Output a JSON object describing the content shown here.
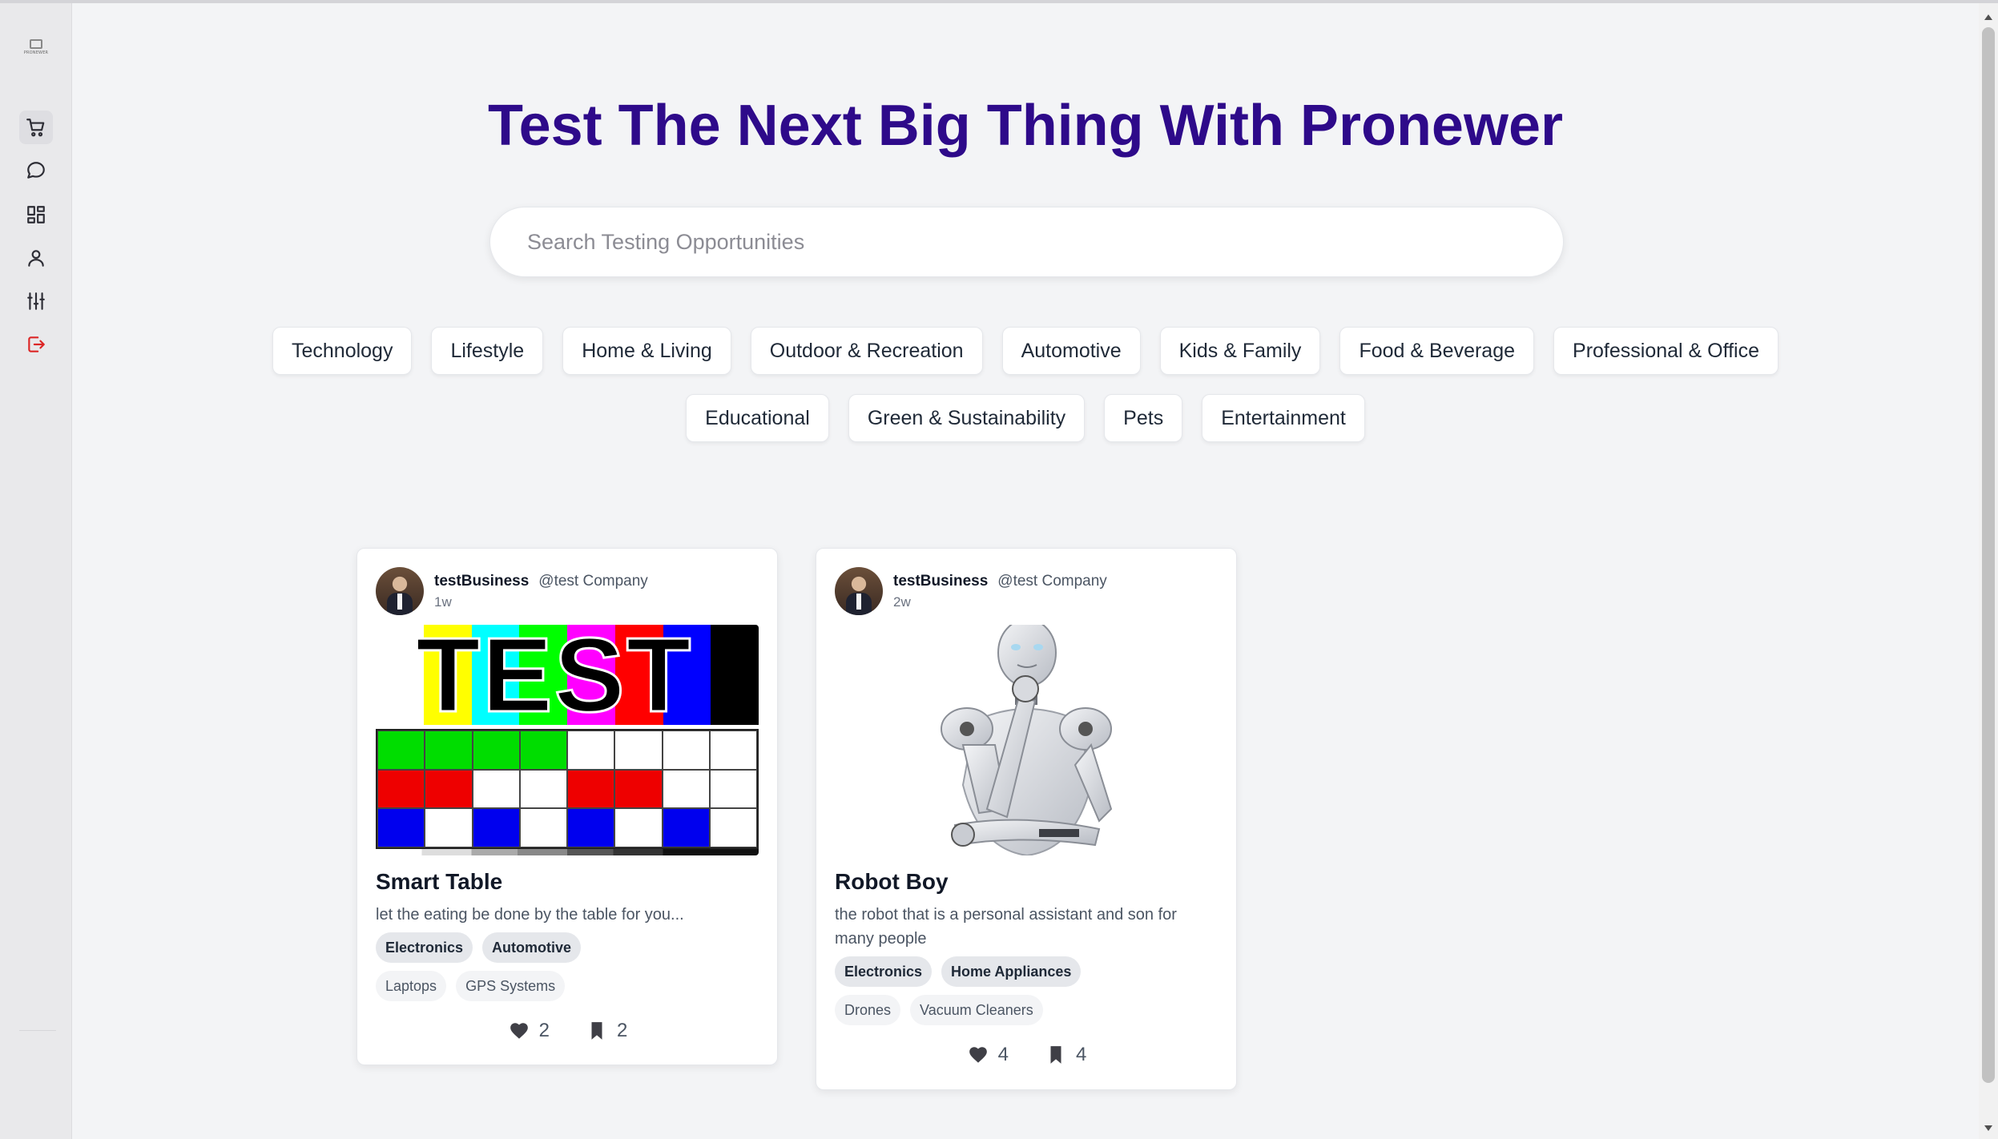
{
  "app": {
    "logo_text": "PRONEWER"
  },
  "sidebar": {
    "items": [
      {
        "name": "marketplace",
        "icon": "shopping-cart-icon"
      },
      {
        "name": "messages",
        "icon": "chat-bubble-icon"
      },
      {
        "name": "dashboard",
        "icon": "dashboard-grid-icon"
      },
      {
        "name": "profile",
        "icon": "user-icon"
      },
      {
        "name": "settings",
        "icon": "sliders-icon"
      },
      {
        "name": "logout",
        "icon": "logout-icon"
      }
    ]
  },
  "hero": {
    "title": "Test The Next Big Thing With Pronewer"
  },
  "search": {
    "placeholder": "Search Testing Opportunities",
    "value": ""
  },
  "categories": [
    "Technology",
    "Lifestyle",
    "Home & Living",
    "Outdoor & Recreation",
    "Automotive",
    "Kids & Family",
    "Food & Beverage",
    "Professional & Office",
    "Educational",
    "Green & Sustainability",
    "Pets",
    "Entertainment"
  ],
  "cards": [
    {
      "username": "testBusiness",
      "handle": "@test Company",
      "time": "1w",
      "image": "TEST",
      "title": "Smart Table",
      "description": "let the eating be done by the table for you...",
      "tags_primary": [
        "Electronics",
        "Automotive"
      ],
      "tags_secondary": [
        "Laptops",
        "GPS Systems"
      ],
      "likes": "2",
      "bookmarks": "2"
    },
    {
      "username": "testBusiness",
      "handle": "@test Company",
      "time": "2w",
      "image": "robot",
      "title": "Robot Boy",
      "description": "the robot that is a personal assistant and son for many people",
      "tags_primary": [
        "Electronics",
        "Home Appliances"
      ],
      "tags_secondary": [
        "Drones",
        "Vacuum Cleaners"
      ],
      "likes": "4",
      "bookmarks": "4"
    }
  ],
  "colors": {
    "title": "#2e0a8a",
    "logout": "#dc2626",
    "background": "#f3f4f6"
  }
}
